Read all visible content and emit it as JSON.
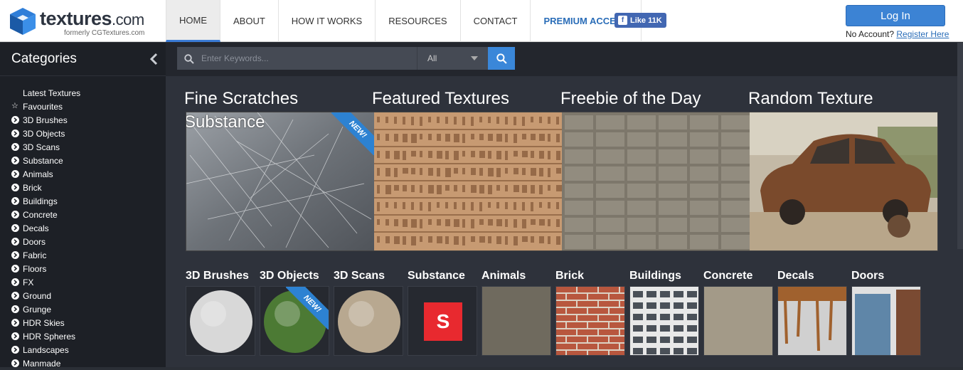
{
  "brand": {
    "name": "textures",
    "tld": ".com",
    "formerly": "formerly CGTextures.com"
  },
  "nav": [
    {
      "label": "HOME",
      "active": true
    },
    {
      "label": "ABOUT"
    },
    {
      "label": "HOW IT WORKS"
    },
    {
      "label": "RESOURCES"
    },
    {
      "label": "CONTACT"
    },
    {
      "label": "PREMIUM ACCESS",
      "premium": true
    }
  ],
  "fb": {
    "label": "Like 11K"
  },
  "account": {
    "login_label": "Log In",
    "no_account": "No Account?",
    "register": "Register Here"
  },
  "sidebar": {
    "title": "Categories",
    "items": [
      "Latest Textures",
      "Favourites",
      "3D Brushes",
      "3D Objects",
      "3D Scans",
      "Substance",
      "Animals",
      "Brick",
      "Buildings",
      "Concrete",
      "Decals",
      "Doors",
      "Fabric",
      "Floors",
      "FX",
      "Ground",
      "Grunge",
      "HDR Skies",
      "HDR Spheres",
      "Landscapes",
      "Manmade"
    ]
  },
  "search": {
    "placeholder": "Enter Keywords...",
    "select_value": "All"
  },
  "features": {
    "titles": [
      "Fine Scratches",
      "Featured Textures",
      "Freebie of the Day",
      "Random Texture"
    ],
    "sub": "Substance",
    "new_badge": "NEW!"
  },
  "categories": [
    "3D Brushes",
    "3D Objects",
    "3D Scans",
    "Substance",
    "Animals",
    "Brick",
    "Buildings",
    "Concrete",
    "Decals",
    "Doors"
  ],
  "colors": {
    "accent": "#3c83d4",
    "sidebar_bg": "#1d2026",
    "main_bg": "#2e323b"
  }
}
